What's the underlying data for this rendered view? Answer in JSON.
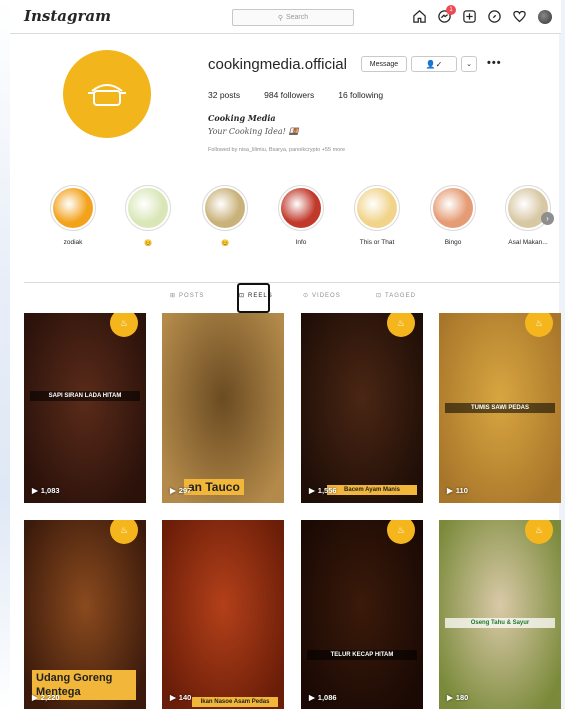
{
  "app": {
    "logo": "Instagram"
  },
  "search": {
    "placeholder": "Search"
  },
  "nav": {
    "notification_count": "1"
  },
  "profile": {
    "username": "cookingmedia.official",
    "message_label": "Message",
    "posts": "32 posts",
    "followers": "984 followers",
    "following": "16 following",
    "full_name": "Cooking Media",
    "bio": "Your Cooking Idea! 🍱",
    "followed_by": "Followed by nisa_lilimiu, Bsarya, panoikcrypto +55 more"
  },
  "highlights": [
    {
      "label": "zodiak",
      "color": "#f3a21c"
    },
    {
      "label": "😊",
      "color": "#d9e7b8"
    },
    {
      "label": "😊",
      "color": "#c9b27a"
    },
    {
      "label": "Info",
      "color": "#c0392b"
    },
    {
      "label": "This or That",
      "color": "#f1d48a"
    },
    {
      "label": "Bingo",
      "color": "#e59b74"
    },
    {
      "label": "Asal Makan...",
      "color": "#d8c7a3"
    }
  ],
  "tabs": [
    {
      "label": "POSTS",
      "icon": "grid-icon"
    },
    {
      "label": "REELS",
      "icon": "reels-icon"
    },
    {
      "label": "VIDEOS",
      "icon": "video-icon"
    },
    {
      "label": "TAGGED",
      "icon": "tag-icon"
    }
  ],
  "posts": [
    {
      "views": "1,083",
      "caption": "SAPI SIRAN LADA HITAM",
      "c1": "#5a2b1a",
      "c2": "#2a110a"
    },
    {
      "views": "297",
      "caption": "an Tauco",
      "c1": "#6b4b22",
      "c2": "#b38a4a"
    },
    {
      "views": "1,556",
      "caption": "Bacem Ayam Manis",
      "c1": "#4a2614",
      "c2": "#1f0e07"
    },
    {
      "views": "110",
      "caption": "TUMIS SAWI PEDAS",
      "c1": "#d8a640",
      "c2": "#a8762a"
    },
    {
      "views": "2,220",
      "caption": "Udang Goreng Mentega",
      "c1": "#8a4a1e",
      "c2": "#3b1a0b"
    },
    {
      "views": "140",
      "caption": "Ikan Nasoe Asam Pedas",
      "c1": "#b3401a",
      "c2": "#6a1d08"
    },
    {
      "views": "1,086",
      "caption": "TELUR KECAP HITAM",
      "c1": "#3a1a0a",
      "c2": "#1a0904"
    },
    {
      "views": "180",
      "caption": "Oseng Tahu & Sayur",
      "c1": "#d9c9a8",
      "c2": "#7a8a3a"
    }
  ]
}
